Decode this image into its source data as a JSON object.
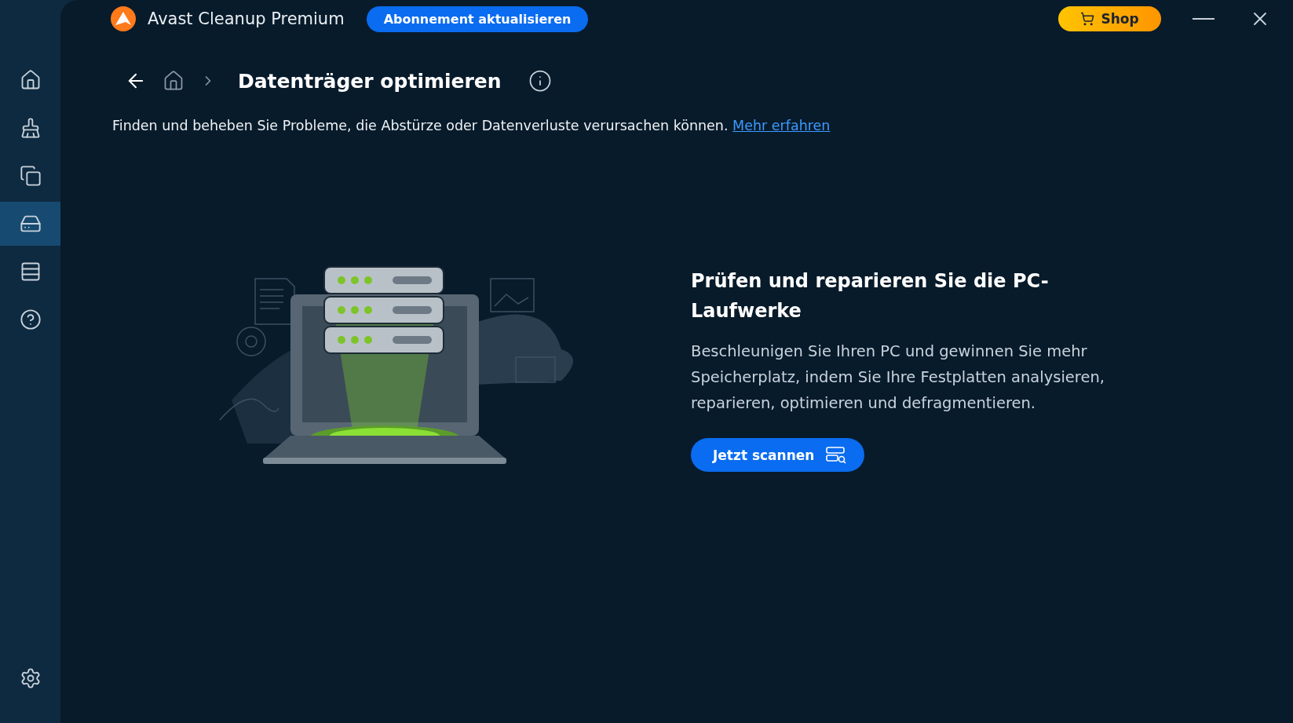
{
  "window": {
    "title": "Avast Cleanup Premium",
    "upgrade_button": "Abonnement aktualisieren",
    "shop_button": "Shop"
  },
  "sidebar": {
    "items": [
      {
        "kind": "home",
        "selected": false
      },
      {
        "kind": "broom",
        "selected": false
      },
      {
        "kind": "windows",
        "selected": false
      },
      {
        "kind": "drive",
        "selected": true
      },
      {
        "kind": "list",
        "selected": false
      },
      {
        "kind": "help",
        "selected": false
      }
    ],
    "footer": {
      "kind": "settings",
      "selected": false
    }
  },
  "page": {
    "title": "Datenträger optimieren",
    "description": "Finden und beheben Sie Probleme, die Abstürze oder Datenverluste verursachen können.",
    "link": "Mehr erfahren"
  },
  "feature": {
    "heading": "Prüfen und reparieren Sie die PC-Laufwerke",
    "body": "Beschleunigen Sie Ihren PC und gewinnen Sie mehr Speicherplatz, indem Sie Ihre Festplatten analysieren, reparieren, optimieren und defragmentieren.",
    "button": "Jetzt scannen"
  }
}
